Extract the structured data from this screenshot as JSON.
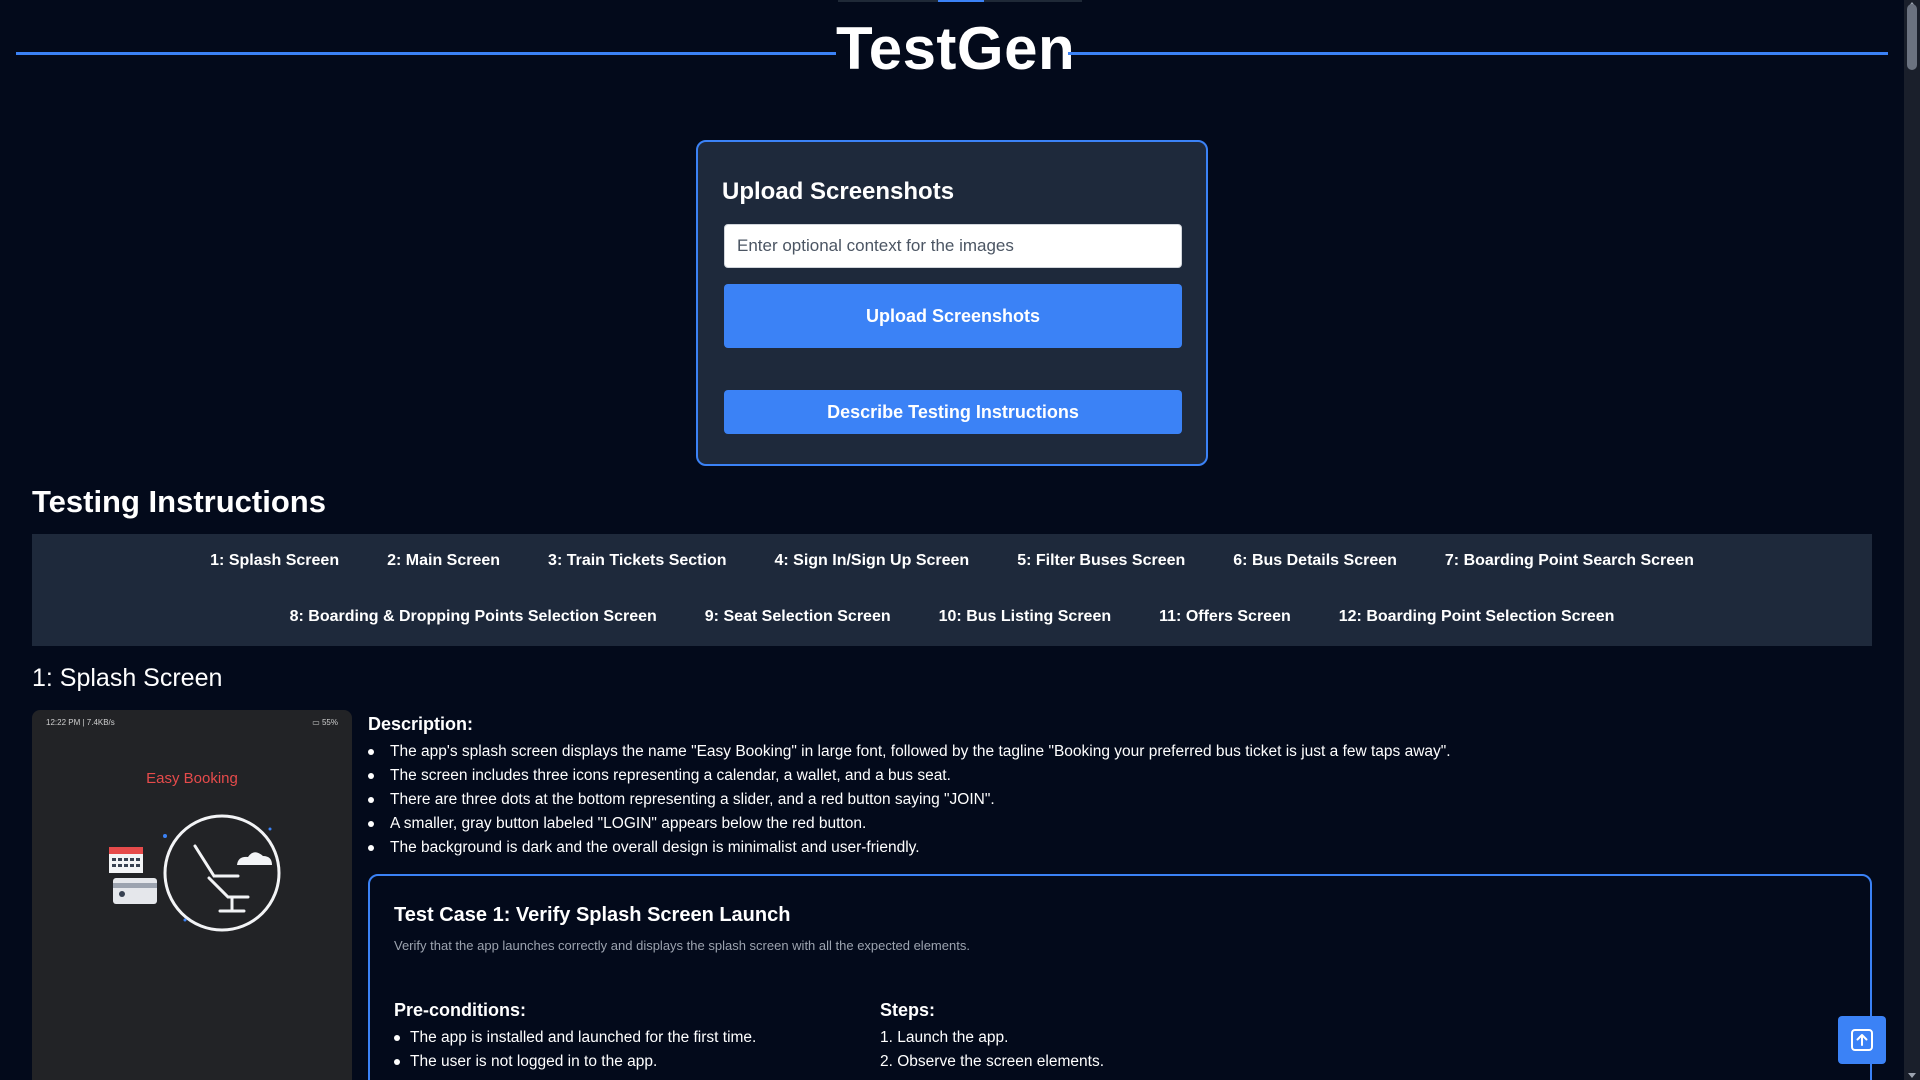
{
  "app": {
    "title": "TestGen"
  },
  "upload": {
    "title": "Upload Screenshots",
    "context_placeholder": "Enter optional context for the images",
    "upload_button": "Upload Screenshots",
    "describe_button": "Describe Testing Instructions"
  },
  "instructions": {
    "heading": "Testing Instructions",
    "nav_row1": [
      "1: Splash Screen",
      "2: Main Screen",
      "3: Train Tickets Section",
      "4: Sign In/Sign Up Screen",
      "5: Filter Buses Screen",
      "6: Bus Details Screen",
      "7: Boarding Point Search Screen"
    ],
    "nav_row2": [
      "8: Boarding & Dropping Points Selection Screen",
      "9: Seat Selection Screen",
      "10: Bus Listing Screen",
      "11: Offers Screen",
      "12: Boarding Point Selection Screen"
    ]
  },
  "screen1": {
    "heading": "1: Splash Screen",
    "phone": {
      "status_left": "12:22 PM | 7.4KB/s",
      "status_right": "55%",
      "app_name": "Easy Booking"
    },
    "description_label": "Description:",
    "description": [
      "The app's splash screen displays the name \"Easy Booking\" in large font, followed by the tagline \"Booking your preferred bus ticket is just a few taps away\".",
      "The screen includes three icons representing a calendar, a wallet, and a bus seat.",
      "There are three dots at the bottom representing a slider, and a red button saying \"JOIN\".",
      "A smaller, gray button labeled \"LOGIN\" appears below the red button.",
      "The background is dark and the overall design is minimalist and user-friendly."
    ],
    "test_case": {
      "title": "Test Case 1: Verify Splash Screen Launch",
      "description": "Verify that the app launches correctly and displays the splash screen with all the expected elements.",
      "preconditions_label": "Pre-conditions:",
      "preconditions": [
        "The app is installed and launched for the first time.",
        "The user is not logged in to the app."
      ],
      "steps_label": "Steps:",
      "steps": [
        "1. Launch the app.",
        "2. Observe the screen elements."
      ]
    }
  },
  "colors": {
    "background": "#030a1b",
    "card": "#1e293b",
    "accent": "#3b82f6",
    "phone_accent": "#e64b4b"
  }
}
